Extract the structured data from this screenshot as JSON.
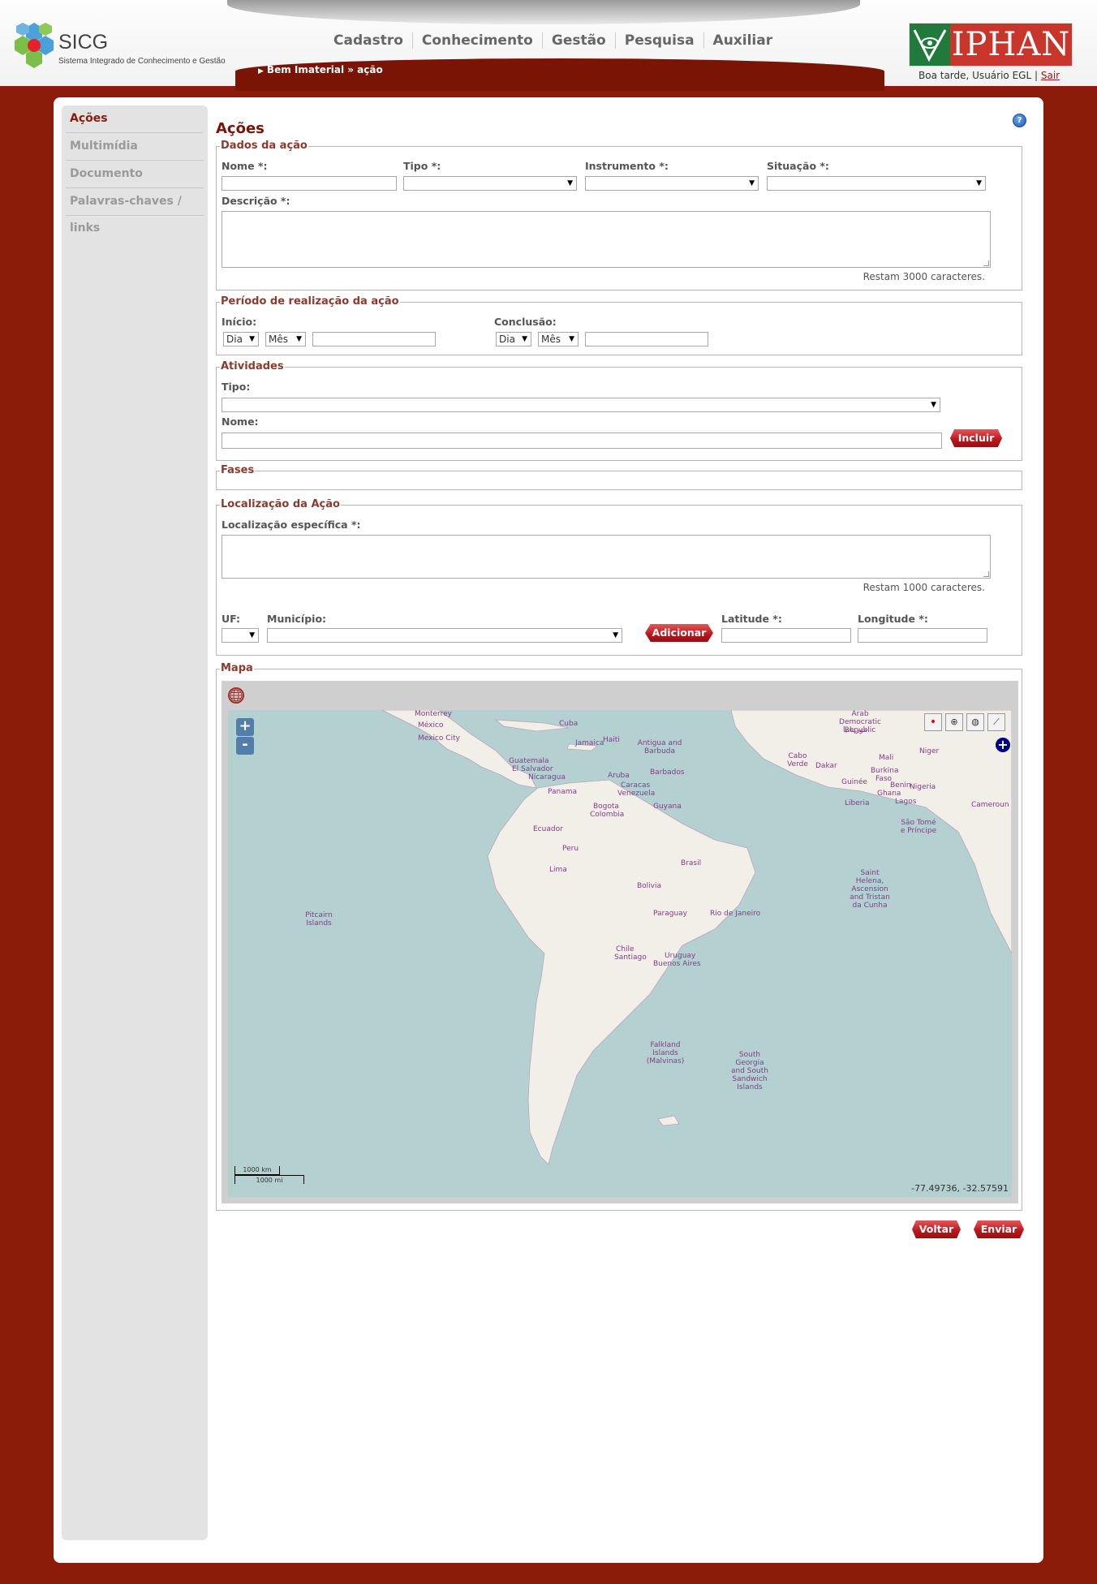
{
  "brand": {
    "title": "SICG",
    "subtitle": "Sistema Integrado de Conhecimento e Gestão"
  },
  "nav": [
    "Cadastro",
    "Conhecimento",
    "Gestão",
    "Pesquisa",
    "Auxiliar"
  ],
  "breadcrumb": "Bem Imaterial » ação",
  "partner_logo": "IPHAN",
  "user": {
    "greeting": "Boa tarde, Usuário EGL",
    "separator": "|",
    "logout": "Sair"
  },
  "sidebar": [
    {
      "label": "Ações",
      "active": true
    },
    {
      "label": "Multimídia"
    },
    {
      "label": "Documento"
    },
    {
      "label": "Palavras-chaves / links"
    }
  ],
  "page_title": "Ações",
  "help_label": "?",
  "dados": {
    "legend": "Dados da ação",
    "nome_label": "Nome *:",
    "tipo_label": "Tipo *:",
    "instrumento_label": "Instrumento *:",
    "situacao_label": "Situação *:",
    "descricao_label": "Descrição *:",
    "counter": "Restam 3000 caracteres."
  },
  "periodo": {
    "legend": "Período de realização da ação",
    "inicio_label": "Início:",
    "conclusao_label": "Conclusão:",
    "dia": "Dia",
    "mes": "Mês"
  },
  "atividades": {
    "legend": "Atividades",
    "tipo_label": "Tipo:",
    "nome_label": "Nome:",
    "incluir": "Incluir"
  },
  "fases": {
    "legend": "Fases"
  },
  "localizacao": {
    "legend": "Localização da Ação",
    "especifica_label": "Localização específica *:",
    "counter": "Restam 1000 caracteres.",
    "uf_label": "UF:",
    "municipio_label": "Município:",
    "adicionar": "Adicionar",
    "latitude_label": "Latitude *:",
    "longitude_label": "Longitude *:"
  },
  "mapa": {
    "legend": "Mapa",
    "zoom_in": "+",
    "zoom_out": "-",
    "layer_switcher": "+",
    "scale_km": "1000 km",
    "scale_mi": "1000 mi",
    "coords": "-77.49736, -32.57591",
    "labels": [
      "Monterrey",
      "México",
      "Mexico City",
      "Cuba",
      "Haiti",
      "Jamaica",
      "Antigua and Barbuda",
      "Guatemala",
      "El Salvador",
      "Nicaragua",
      "Barbados",
      "Aruba",
      "Caracas",
      "Venezuela",
      "Panama",
      "Bogota",
      "Colombia",
      "Guyana",
      "Ecuador",
      "Peru",
      "Lima",
      "Brasil",
      "Bolivia",
      "Paraguay",
      "Rio de Janeiro",
      "Chile",
      "Santiago",
      "Uruguay",
      "Buenos Aires",
      "Pitcairn Islands",
      "Falkland Islands (Malvinas)",
      "South Georgia and South Sandwich Islands",
      "Saint Helena, Ascension and Tristan da Cunha",
      "Cabo Verde",
      "Dakar",
      "Mali",
      "Niger",
      "Burkina Faso",
      "Guinée",
      "Benin",
      "Ghana",
      "Nigeria",
      "Liberia",
      "Lagos",
      "Cameroun",
      "São Tomé e Príncipe",
      "Arab Democratic Republic",
      "موريتانيا"
    ]
  },
  "actions": {
    "voltar": "Voltar",
    "enviar": "Enviar"
  }
}
